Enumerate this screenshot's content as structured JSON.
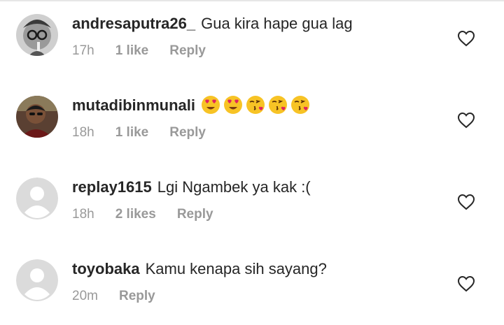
{
  "comments": [
    {
      "username": "andresaputra26_",
      "text": "Gua kira hape gua lag",
      "emoji_text": [],
      "time": "17h",
      "likes": "1 like",
      "reply": "Reply",
      "avatar": "photo-avatar-glasses"
    },
    {
      "username": "mutadibinmunali",
      "text": "",
      "emoji_text": [
        "heart-eyes-emoji",
        "heart-eyes-emoji",
        "kissing-heart-emoji",
        "kissing-heart-emoji",
        "kissing-heart-emoji"
      ],
      "time": "18h",
      "likes": "1 like",
      "reply": "Reply",
      "avatar": "photo-avatar-man"
    },
    {
      "username": "replay1615",
      "text": "Lgi Ngambek ya kak :(",
      "emoji_text": [],
      "time": "18h",
      "likes": "2 likes",
      "reply": "Reply",
      "avatar": "default-avatar"
    },
    {
      "username": "toyobaka",
      "text": "Kamu kenapa sih sayang?",
      "emoji_text": [],
      "time": "20m",
      "likes": "",
      "reply": "Reply",
      "avatar": "default-avatar"
    }
  ],
  "icons": {
    "like": "heart-outline-icon"
  },
  "colors": {
    "username": "#262626",
    "meta": "#999999",
    "default_avatar": "#dbdbdb"
  }
}
